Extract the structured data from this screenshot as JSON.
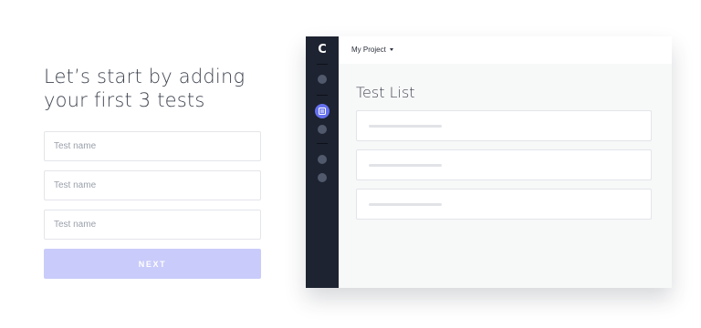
{
  "onboarding": {
    "heading_line1": "Let’s start by adding",
    "heading_line2": "your first 3 tests",
    "fields": [
      {
        "placeholder": "Test name",
        "value": ""
      },
      {
        "placeholder": "Test name",
        "value": ""
      },
      {
        "placeholder": "Test name",
        "value": ""
      }
    ],
    "next_label": "NEXT",
    "next_button_color": "#c9cbfa"
  },
  "app_preview": {
    "logo_text": "C",
    "project_label": "My Project",
    "list_title": "Test List",
    "sidebar_color": "#1d2330",
    "accent_color": "#6571ee",
    "sidebar_icons": [
      "nav-icon",
      "active-list-icon",
      "nav-icon",
      "nav-icon",
      "nav-icon"
    ]
  }
}
